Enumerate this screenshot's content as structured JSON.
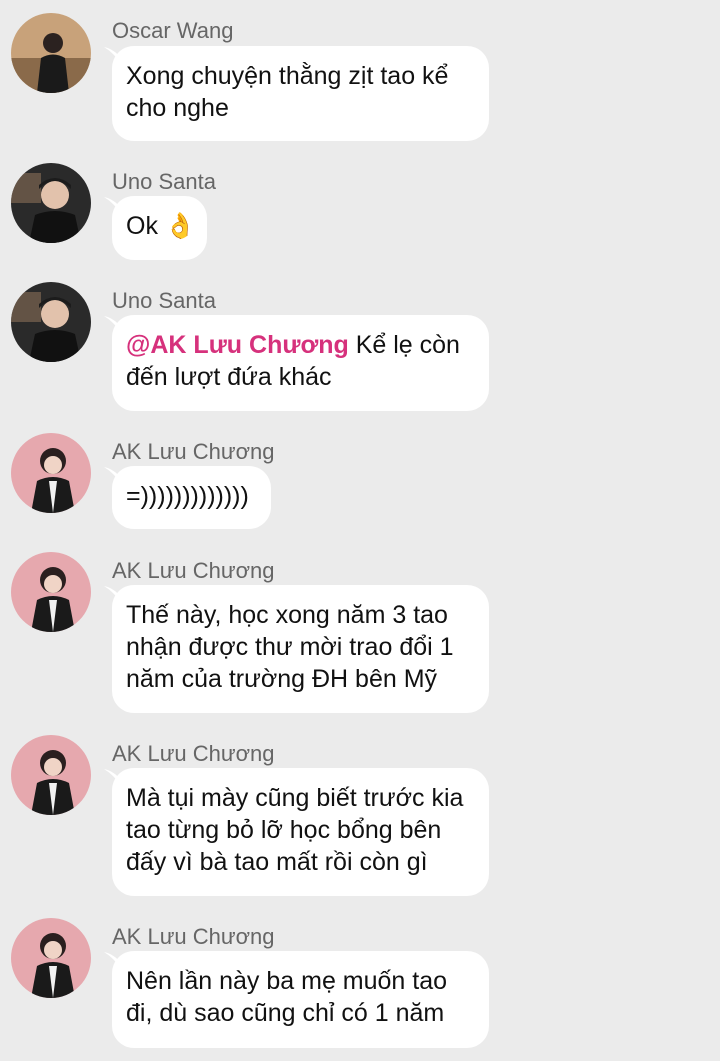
{
  "messages": [
    {
      "sender": "Oscar Wang",
      "avatar": "oscar-avatar",
      "lines": [
        "Xong chuyện thằng zịt tao kể",
        "cho nghe"
      ]
    },
    {
      "sender": "Uno Santa",
      "avatar": "uno-avatar",
      "lines": [
        "Ok 👌"
      ]
    },
    {
      "sender": "Uno Santa",
      "avatar": "uno-avatar",
      "mention": "@AK Lưu Chương",
      "lines": [
        " Kể lẹ còn",
        "đến lượt đứa khác"
      ]
    },
    {
      "sender": "AK Lưu Chương",
      "avatar": "ak-avatar",
      "lines": [
        "=)))))))))))))"
      ]
    },
    {
      "sender": "AK Lưu Chương",
      "avatar": "ak-avatar",
      "lines": [
        "Thế này, học xong năm 3 tao",
        "nhận được thư mời trao đổi 1",
        "năm của trường ĐH bên Mỹ"
      ]
    },
    {
      "sender": "AK Lưu Chương",
      "avatar": "ak-avatar",
      "lines": [
        "Mà tụi mày cũng biết trước kia",
        "tao từng bỏ lỡ học bổng bên",
        "đấy vì bà tao mất rồi còn gì"
      ]
    },
    {
      "sender": "AK Lưu Chương",
      "avatar": "ak-avatar",
      "lines": [
        "Nên lần này ba mẹ muốn tao",
        "đi, dù sao cũng chỉ có 1 năm"
      ]
    }
  ]
}
